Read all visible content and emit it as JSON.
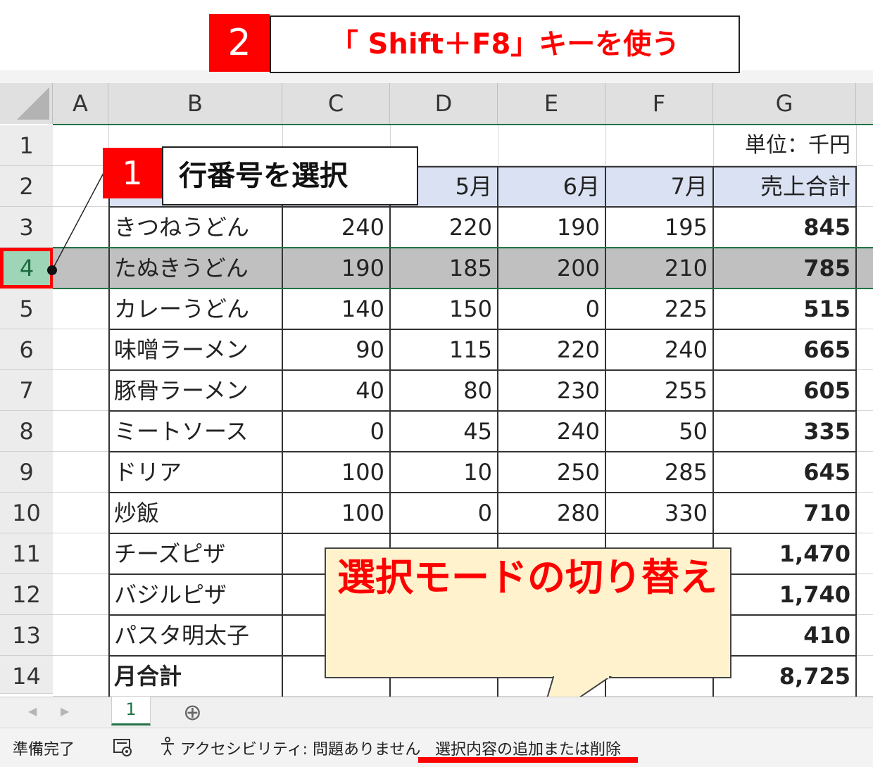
{
  "annotations": {
    "step2_number": "2",
    "step2_text": "「 Shift＋F8」キーを使う",
    "step1_number": "1",
    "step1_text": "行番号を選択",
    "bubble_text": "選択モードの切り替え"
  },
  "sheet": {
    "columns": [
      "A",
      "B",
      "C",
      "D",
      "E",
      "F",
      "G"
    ],
    "row_numbers": [
      "1",
      "2",
      "3",
      "4",
      "5",
      "6",
      "7",
      "8",
      "9",
      "10",
      "11",
      "12",
      "13",
      "14"
    ],
    "unit_label": "単位：千円",
    "header_months": [
      "5月",
      "6月",
      "7月"
    ],
    "header_total": "売上合計",
    "rows": [
      {
        "name": "きつねうどん",
        "c": "240",
        "d": "220",
        "e": "190",
        "f": "195",
        "g": "845"
      },
      {
        "name": "たぬきうどん",
        "c": "190",
        "d": "185",
        "e": "200",
        "f": "210",
        "g": "785"
      },
      {
        "name": "カレーうどん",
        "c": "140",
        "d": "150",
        "e": "0",
        "f": "225",
        "g": "515"
      },
      {
        "name": "味噌ラーメン",
        "c": "90",
        "d": "115",
        "e": "220",
        "f": "240",
        "g": "665"
      },
      {
        "name": "豚骨ラーメン",
        "c": "40",
        "d": "80",
        "e": "230",
        "f": "255",
        "g": "605"
      },
      {
        "name": "ミートソース",
        "c": "0",
        "d": "45",
        "e": "240",
        "f": "50",
        "g": "335"
      },
      {
        "name": "ドリア",
        "c": "100",
        "d": "10",
        "e": "250",
        "f": "285",
        "g": "645"
      },
      {
        "name": "炒飯",
        "c": "100",
        "d": "0",
        "e": "280",
        "f": "330",
        "g": "710"
      },
      {
        "name": "チーズピザ",
        "c": "",
        "d": "",
        "e": "",
        "f": "",
        "g": "1,470"
      },
      {
        "name": "バジルピザ",
        "c": "",
        "d": "",
        "e": "",
        "f": "",
        "g": "1,740"
      },
      {
        "name": "パスタ明太子",
        "c": "",
        "d": "",
        "e": "",
        "f": "",
        "g": "410"
      },
      {
        "name": "月合計",
        "c": "",
        "d": "",
        "e": "",
        "f": "",
        "g": "8,725"
      }
    ]
  },
  "tabs": {
    "sheet_tab": "1",
    "add_sheet": "⊕",
    "nav_prev": "◀",
    "nav_next": "▶"
  },
  "status": {
    "ready": "準備完了",
    "accessibility": "アクセシビリティ: 問題ありません",
    "mode": "選択内容の追加または削除"
  },
  "colors": {
    "badge_red": "#ff0000",
    "selected_row_grey": "#c0c0c0",
    "header_blue": "#d9e1f2",
    "bubble_fill": "#fff2cc",
    "selected_header_green": "#9fd5b7",
    "grid_green": "#217346"
  }
}
